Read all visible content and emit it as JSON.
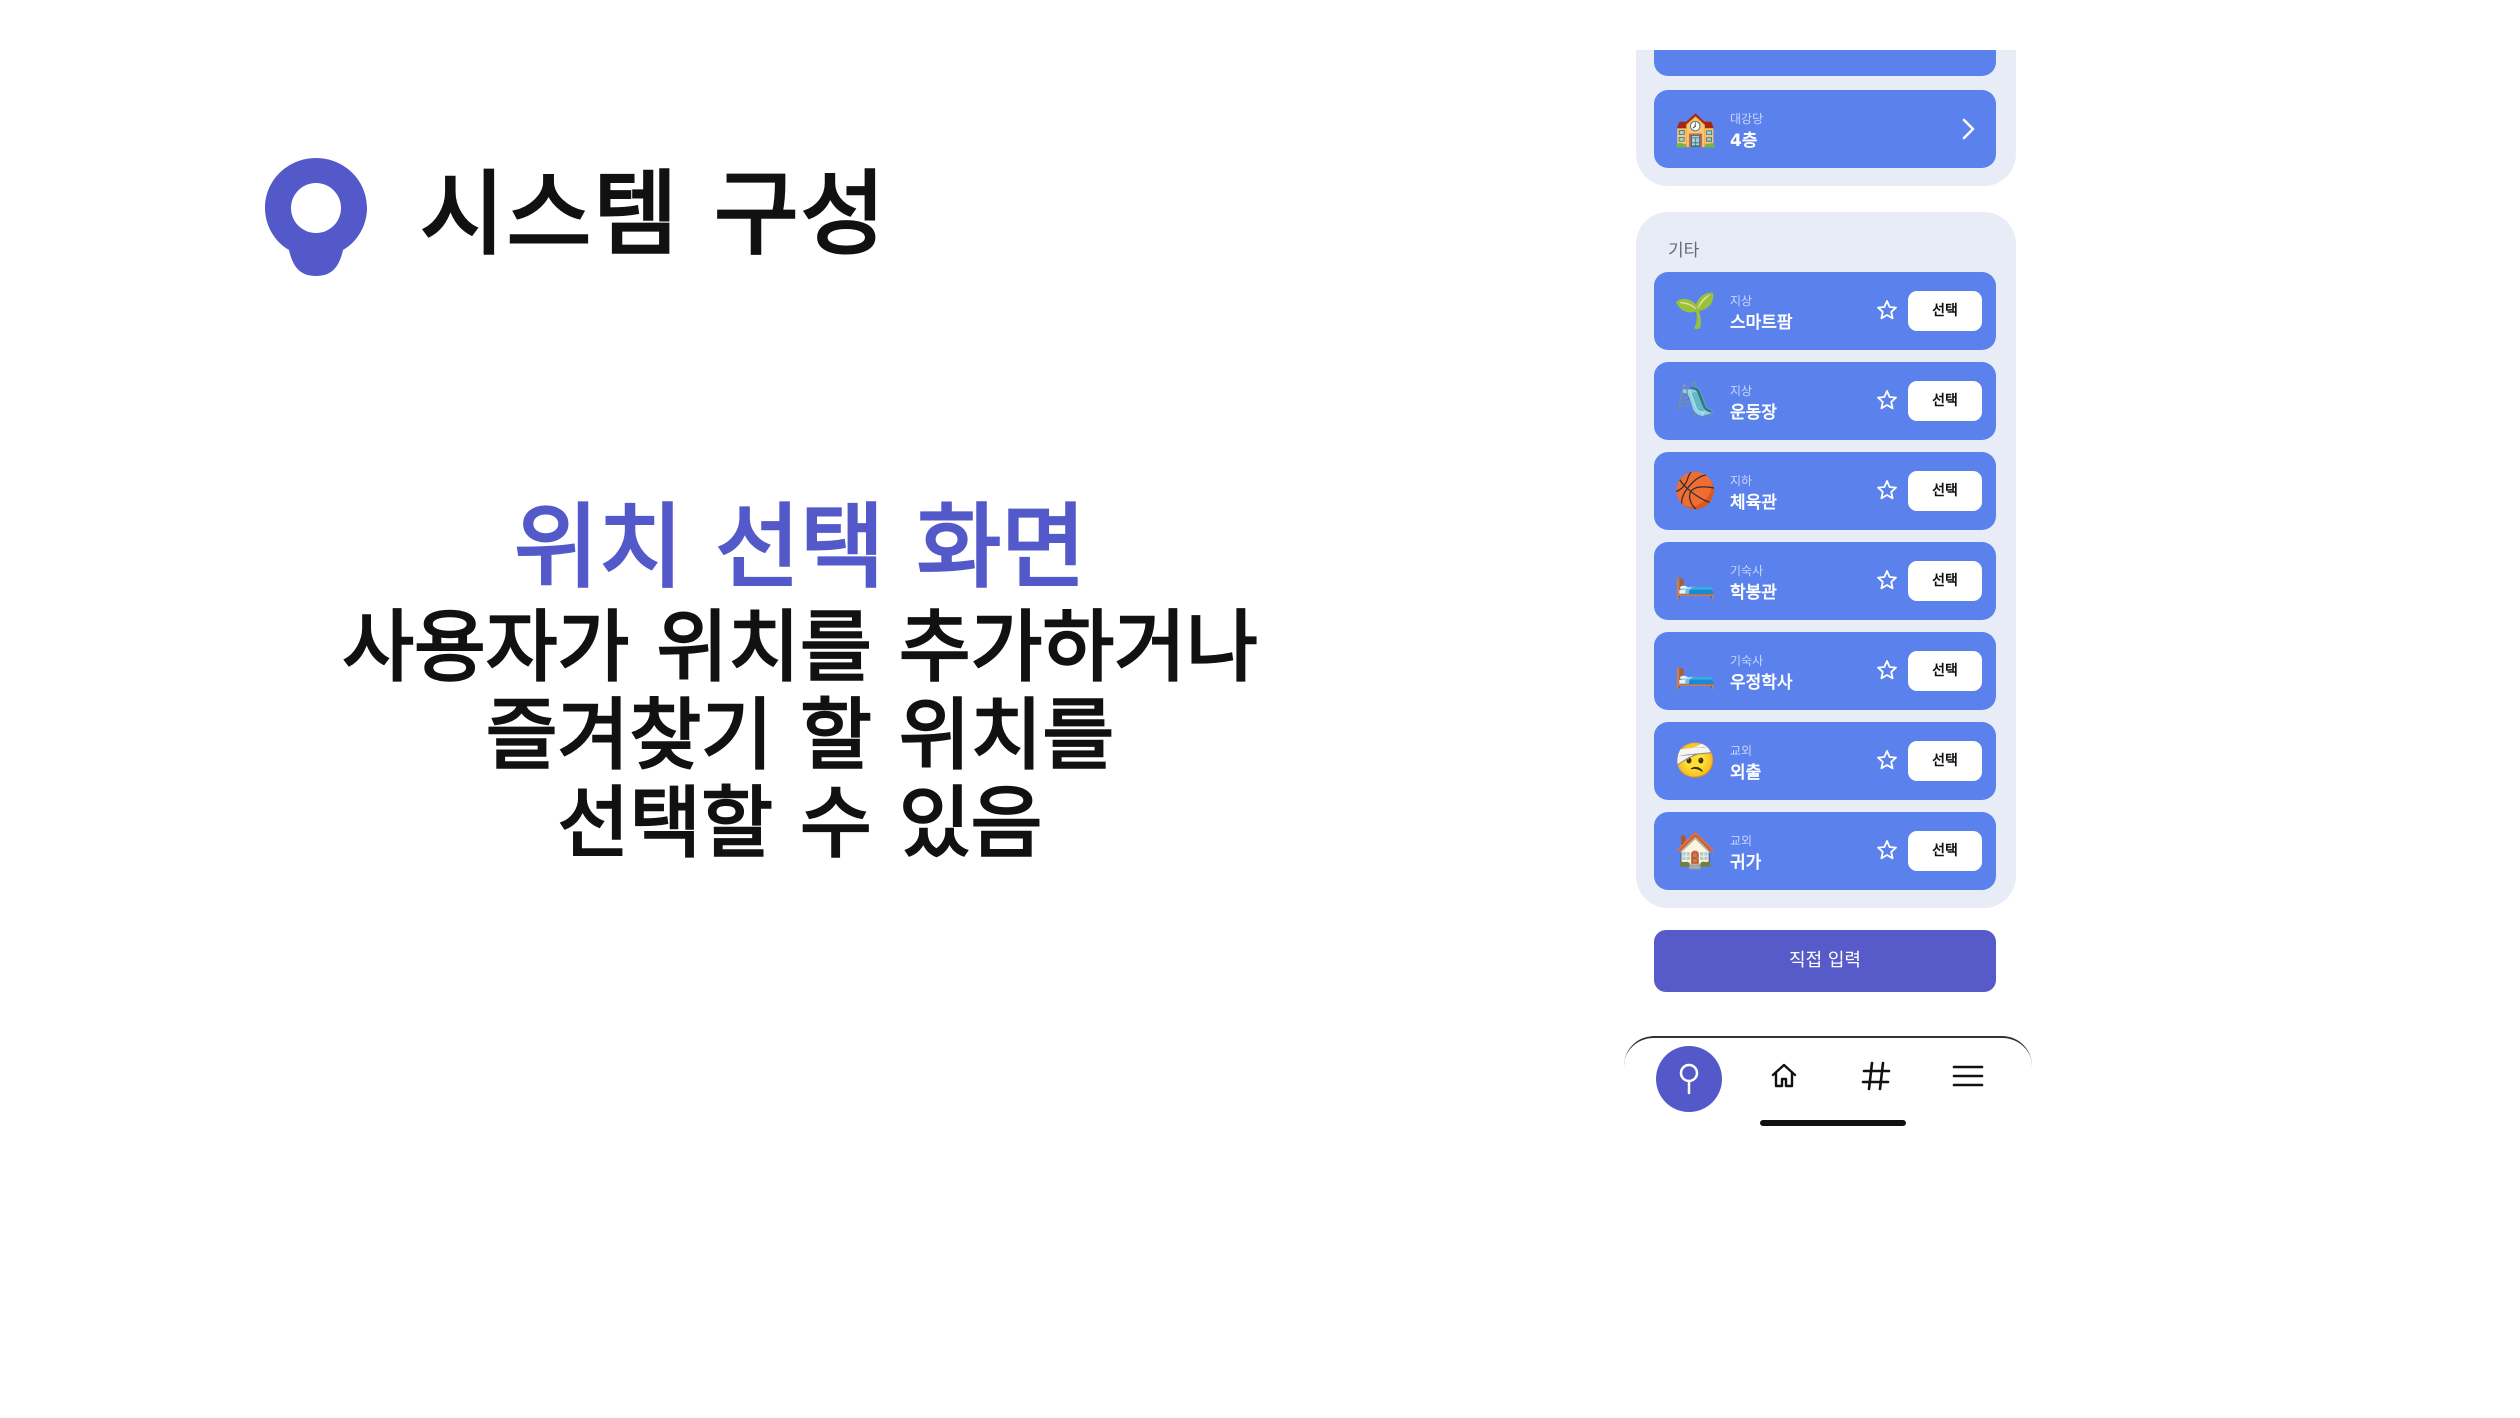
{
  "slide": {
    "title": "시스템 구성",
    "subtitle": "위치 선택 화면",
    "description": [
      "사용자가 위치를 추가하거나",
      "즐겨찾기 할 위치를",
      "선택할 수 있음"
    ],
    "colors": {
      "accent": "#5459c9",
      "card": "#5b82ec",
      "panel": "#e8ecf6",
      "primary_button": "#575ac9"
    }
  },
  "phone": {
    "top_cards": [
      {
        "emoji": "🏫",
        "small": "",
        "name": "",
        "icon": "chevron-right-icon"
      },
      {
        "emoji": "🏫",
        "small": "대강당",
        "name": "4층",
        "icon": "chevron-right-icon"
      }
    ],
    "other_section": {
      "label": "기타",
      "items": [
        {
          "emoji": "🌱",
          "small": "지상",
          "name": "스마트팜",
          "button": "선택"
        },
        {
          "emoji": "🛝",
          "small": "지상",
          "name": "운동장",
          "button": "선택"
        },
        {
          "emoji": "🏀",
          "small": "지하",
          "name": "체육관",
          "button": "선택"
        },
        {
          "emoji": "🛏️",
          "small": "기숙사",
          "name": "학봉관",
          "button": "선택"
        },
        {
          "emoji": "🛏️",
          "small": "기숙사",
          "name": "우정학사",
          "button": "선택"
        },
        {
          "emoji": "🤕",
          "small": "교외",
          "name": "외출",
          "button": "선택"
        },
        {
          "emoji": "🏠",
          "small": "교외",
          "name": "귀가",
          "button": "선택"
        }
      ]
    },
    "direct_input_label": "직접 입력",
    "tabs": [
      "location-pin-icon",
      "home-icon",
      "hashtag-icon",
      "menu-icon"
    ]
  }
}
